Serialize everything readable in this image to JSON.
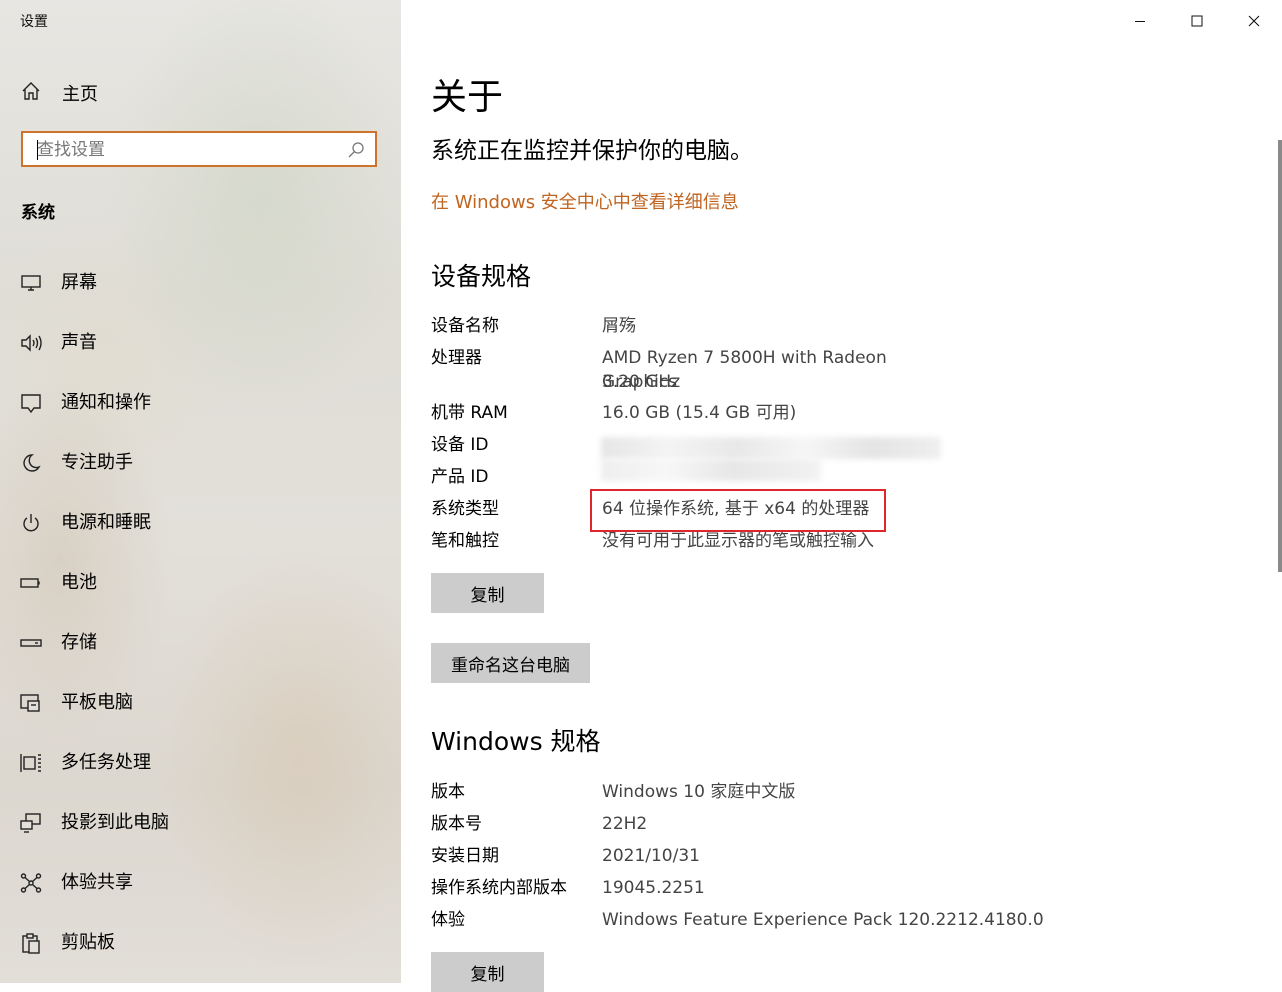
{
  "window": {
    "title": "设置"
  },
  "sidebar": {
    "home_label": "主页",
    "search_placeholder": "查找设置",
    "section": "系统",
    "items": [
      {
        "label": "屏幕",
        "icon": "monitor-icon"
      },
      {
        "label": "声音",
        "icon": "speaker-icon"
      },
      {
        "label": "通知和操作",
        "icon": "notification-icon"
      },
      {
        "label": "专注助手",
        "icon": "moon-icon"
      },
      {
        "label": "电源和睡眠",
        "icon": "power-icon"
      },
      {
        "label": "电池",
        "icon": "battery-icon"
      },
      {
        "label": "存储",
        "icon": "storage-icon"
      },
      {
        "label": "平板电脑",
        "icon": "tablet-icon"
      },
      {
        "label": "多任务处理",
        "icon": "multitasking-icon"
      },
      {
        "label": "投影到此电脑",
        "icon": "project-icon"
      },
      {
        "label": "体验共享",
        "icon": "share-icon"
      },
      {
        "label": "剪贴板",
        "icon": "clipboard-icon"
      }
    ]
  },
  "main": {
    "title": "关于",
    "subtitle": "系统正在监控并保护你的电脑。",
    "security_link": "在 Windows 安全中心中查看详细信息",
    "device_specs": {
      "heading": "设备规格",
      "rows": [
        {
          "key": "设备名称",
          "value": "屑殇"
        },
        {
          "key": "处理器",
          "value": "AMD Ryzen 7 5800H with Radeon Graphics",
          "value2": "3.20 GHz"
        },
        {
          "key": "机带 RAM",
          "value": "16.0 GB (15.4 GB 可用)"
        },
        {
          "key": "设备 ID",
          "value": ""
        },
        {
          "key": "产品 ID",
          "value": ""
        },
        {
          "key": "系统类型",
          "value": "64 位操作系统, 基于 x64 的处理器"
        },
        {
          "key": "笔和触控",
          "value": "没有可用于此显示器的笔或触控输入"
        }
      ],
      "copy_button": "复制",
      "rename_button": "重命名这台电脑"
    },
    "windows_specs": {
      "heading": "Windows 规格",
      "rows": [
        {
          "key": "版本",
          "value": "Windows 10 家庭中文版"
        },
        {
          "key": "版本号",
          "value": "22H2"
        },
        {
          "key": "安装日期",
          "value": "2021/10/31"
        },
        {
          "key": "操作系统内部版本",
          "value": "19045.2251"
        },
        {
          "key": "体验",
          "value": "Windows Feature Experience Pack 120.2212.4180.0"
        }
      ],
      "copy_button": "复制"
    }
  },
  "colors": {
    "accent": "#d0732a",
    "link": "#c06420",
    "highlight": "#e0262d",
    "button": "#cccccc"
  }
}
